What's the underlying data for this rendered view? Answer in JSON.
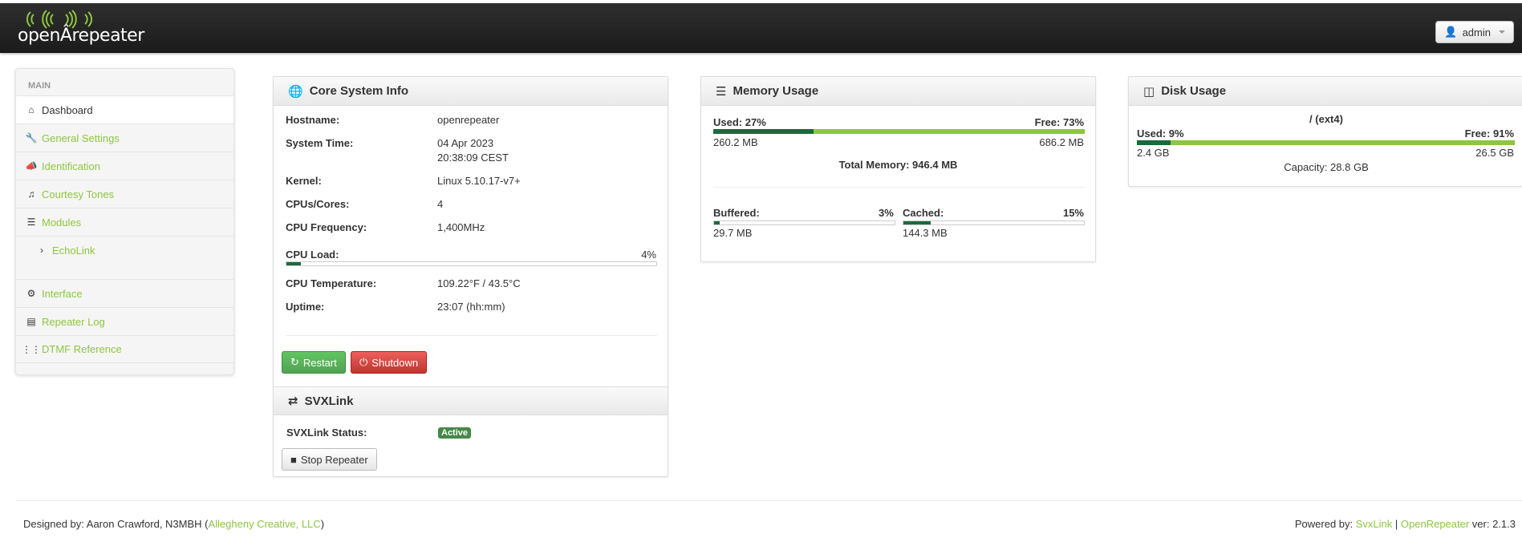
{
  "header": {
    "logo_text_open": "open",
    "logo_text_repeater": "repeater",
    "user_label": "admin"
  },
  "sidebar": {
    "section": "MAIN",
    "items": [
      {
        "label": "Dashboard",
        "icon": "home-icon"
      },
      {
        "label": "General Settings",
        "icon": "wrench-icon"
      },
      {
        "label": "Identification",
        "icon": "bullhorn-icon"
      },
      {
        "label": "Courtesy Tones",
        "icon": "music-icon"
      },
      {
        "label": "Modules",
        "icon": "list-icon"
      },
      {
        "label": "EchoLink",
        "icon": "chevron-right-icon"
      },
      {
        "label": "Interface",
        "icon": "cog-icon"
      },
      {
        "label": "Repeater Log",
        "icon": "list-alt-icon"
      },
      {
        "label": "DTMF Reference",
        "icon": "th-icon"
      }
    ]
  },
  "core": {
    "title": "Core System Info",
    "hostname_label": "Hostname:",
    "hostname": "openrepeater",
    "time_label": "System Time:",
    "date": "04 Apr 2023",
    "time": "20:38:09 CEST",
    "kernel_label": "Kernel:",
    "kernel": "Linux 5.10.17-v7+",
    "cpus_label": "CPUs/Cores:",
    "cpus": "4",
    "freq_label": "CPU Frequency:",
    "freq": "1,400MHz",
    "load_label": "CPU Load:",
    "load_text": "4%",
    "load": 0.04,
    "temp_label": "CPU Temperature:",
    "temp": "109.22°F / 43.5°C",
    "uptime_label": "Uptime:",
    "uptime": "23:07 (hh:mm)",
    "restart_label": "Restart",
    "shutdown_label": "Shutdown"
  },
  "svx": {
    "title": "SVXLink",
    "status_label": "SVXLink Status:",
    "status": "Active",
    "stop_label": "Stop Repeater"
  },
  "memory": {
    "title": "Memory Usage",
    "used_label": "Used: 27%",
    "free_label": "Free: 73%",
    "used": 0.27,
    "used_val": "260.2 MB",
    "free_val": "686.2 MB",
    "total": "Total Memory: 946.4 MB",
    "buffered_label": "Buffered:",
    "buffered_pct": "3%",
    "buffered": 0.03,
    "buffered_val": "29.7 MB",
    "cached_label": "Cached:",
    "cached_pct": "15%",
    "cached": 0.15,
    "cached_val": "144.3 MB"
  },
  "disk": {
    "title": "Disk Usage",
    "mount": "/ (ext4)",
    "used_label": "Used: 9%",
    "free_label": "Free: 91%",
    "used": 0.09,
    "used_val": "2.4 GB",
    "free_val": "26.5 GB",
    "capacity": "Capacity: 28.8 GB"
  },
  "footer": {
    "designed_prefix": "Designed by: Aaron Crawford, N3MBH (",
    "designed_link": "Allegheny Creative, LLC",
    "designed_suffix": ")",
    "powered_prefix": "Powered by: ",
    "svxlink_link": "SvxLink",
    "sep": " | ",
    "openrepeater_link": "OpenRepeater",
    "version": " ver: 2.1.3"
  },
  "colors": {
    "accent": "#8dc63f",
    "bar_dark": "#1a6b3c",
    "active_badge": "#468847"
  }
}
